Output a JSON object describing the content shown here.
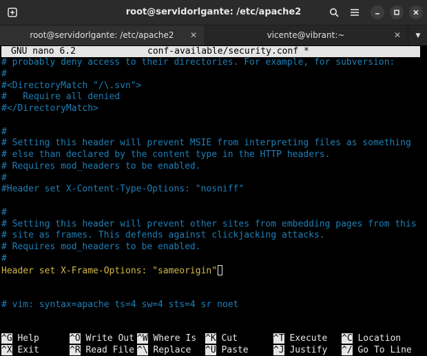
{
  "window": {
    "title": "root@servidorlgante: /etc/apache2",
    "new_tab_icon": "new-tab-icon",
    "search_icon": "search-icon",
    "menu_icon": "hamburger-menu-icon",
    "minimize_icon": "minimize-icon",
    "maximize_icon": "maximize-icon",
    "close_icon": "close-icon"
  },
  "tabs": [
    {
      "label": "root@servidorlgante: /etc/apache2",
      "active": true
    },
    {
      "label": "vicente@vibrant:~",
      "active": false
    }
  ],
  "nano": {
    "version": "GNU nano 6.2",
    "filename": "conf-available/security.conf *"
  },
  "lines": [
    "# probably deny access to their directories. For example, for subversion:",
    "#",
    "#<DirectoryMatch \"/\\.svn\">",
    "#   Require all denied",
    "#</DirectoryMatch>",
    "",
    "#",
    "# Setting this header will prevent MSIE from interpreting files as something",
    "# else than declared by the content type in the HTTP headers.",
    "# Requires mod_headers to be enabled.",
    "#",
    "#Header set X-Content-Type-Options: \"nosniff\"",
    "",
    "#",
    "# Setting this header will prevent other sites from embedding pages from this",
    "# site as frames. This defends against clickjacking attacks.",
    "# Requires mod_headers to be enabled.",
    "#",
    "Header set X-Frame-Options: \"sameorigin\"",
    "",
    "",
    "# vim: syntax=apache ts=4 sw=4 sts=4 sr noet"
  ],
  "shortcuts": [
    {
      "key": "^G",
      "label": "Help"
    },
    {
      "key": "^O",
      "label": "Write Out"
    },
    {
      "key": "^W",
      "label": "Where Is"
    },
    {
      "key": "^K",
      "label": "Cut"
    },
    {
      "key": "^T",
      "label": "Execute"
    },
    {
      "key": "^C",
      "label": "Location"
    },
    {
      "key": "^X",
      "label": "Exit"
    },
    {
      "key": "^R",
      "label": "Read File"
    },
    {
      "key": "^\\",
      "label": "Replace"
    },
    {
      "key": "^U",
      "label": "Paste"
    },
    {
      "key": "^J",
      "label": "Justify"
    },
    {
      "key": "^/",
      "label": "Go To Line"
    }
  ],
  "colors": {
    "comment": "#1e7fb8",
    "directive": "#d4b84a",
    "header_bg": "#e5e5e5"
  }
}
